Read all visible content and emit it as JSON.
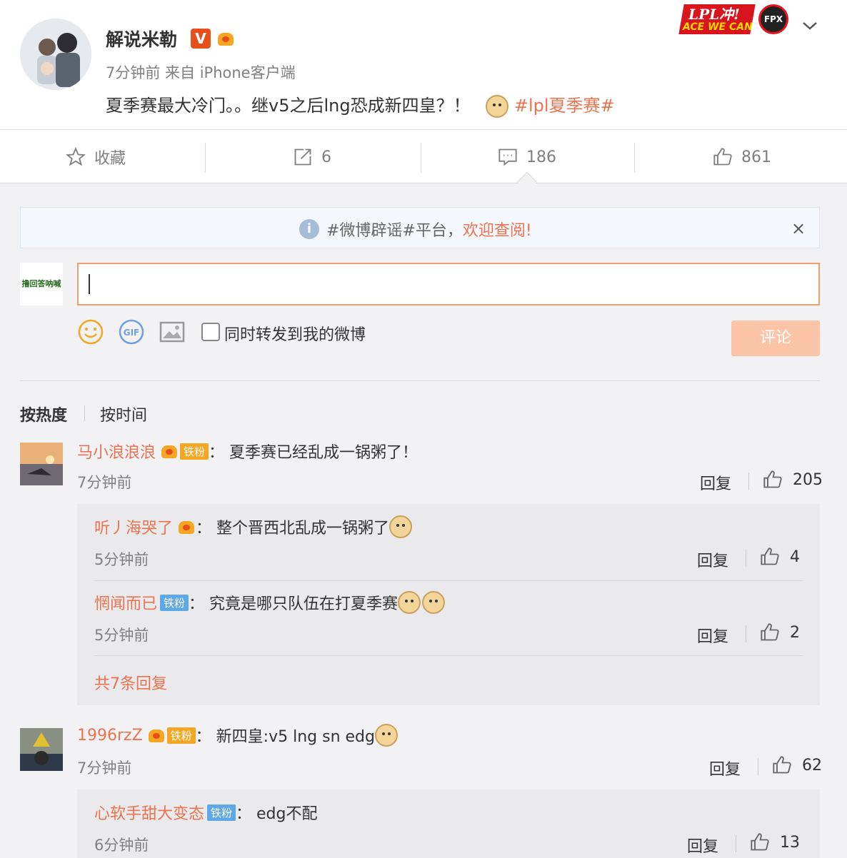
{
  "post": {
    "author": "解说米勒",
    "v_badge": "V",
    "meta": "7分钟前 来自 iPhone客户端",
    "text": "夏季赛最大冷门。。继v5之后lng恐成新四皇？！",
    "hashtag": "#lpl夏季赛#"
  },
  "banner": {
    "line1": "LPL冲!",
    "line2": "ACE WE CAN",
    "logo": "FPX"
  },
  "actions": {
    "collect": "收藏",
    "repost_count": "6",
    "comment_count": "186",
    "like_count": "861"
  },
  "notice": {
    "prefix": "#微博辟谣#平台，",
    "link": "欢迎查阅!",
    "close": "×"
  },
  "composer": {
    "avatar_text": "撸回答呐喊",
    "checkbox_label": "同时转发到我的微博",
    "submit_label": "评论"
  },
  "sort": {
    "hot": "按热度",
    "time": "按时间"
  },
  "comments": [
    {
      "user": "马小浪浪浪",
      "badge": "铁粉",
      "text": "：  夏季赛已经乱成一锅粥了！",
      "time": "7分钟前",
      "reply": "回复",
      "likes": "205",
      "replies": [
        {
          "user": "听丿海哭了",
          "text": "：  整个晋西北乱成一锅粥了",
          "time": "5分钟前",
          "reply": "回复",
          "likes": "4"
        },
        {
          "user": "惘闻而已",
          "badge": "铁粉",
          "text": "：  究竟是哪只队伍在打夏季赛",
          "time": "5分钟前",
          "reply": "回复",
          "likes": "2"
        }
      ],
      "more": "共7条回复"
    },
    {
      "user": "1996rzZ",
      "badge": "铁粉",
      "text": "：  新四皇:v5 lng sn edg",
      "time": "7分钟前",
      "reply": "回复",
      "likes": "62",
      "replies": [
        {
          "user": "心软手甜大变态",
          "badge": "铁粉",
          "text": "：  edg不配",
          "time": "6分钟前",
          "reply": "回复",
          "likes": "13"
        }
      ]
    }
  ],
  "colors": {
    "accent": "#eb7350",
    "text": "#333333",
    "muted": "#808080",
    "bg": "#f2f2f5"
  }
}
